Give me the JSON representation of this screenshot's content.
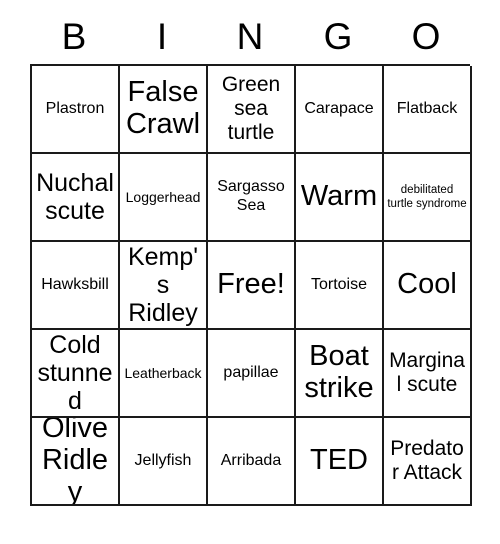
{
  "card": {
    "header": {
      "letters": [
        "B",
        "I",
        "N",
        "G",
        "O"
      ]
    },
    "columns": 5,
    "rows": 5,
    "free_space_label": "Free!",
    "cells": [
      {
        "text": "Plastron",
        "size": "md"
      },
      {
        "text": "False Crawl",
        "size": "xxl"
      },
      {
        "text": "Green sea turtle",
        "size": "lg"
      },
      {
        "text": "Carapace",
        "size": "md"
      },
      {
        "text": "Flatback",
        "size": "md"
      },
      {
        "text": "Nuchal scute",
        "size": "xl"
      },
      {
        "text": "Loggerhead",
        "size": "sm"
      },
      {
        "text": "Sargasso Sea",
        "size": "md"
      },
      {
        "text": "Warm",
        "size": "xxl"
      },
      {
        "text": "debilitated turtle syndrome",
        "size": "xs"
      },
      {
        "text": "Hawksbill",
        "size": "md"
      },
      {
        "text": "Kemp's Ridley",
        "size": "xl"
      },
      {
        "text": "Free!",
        "size": "xxl"
      },
      {
        "text": "Tortoise",
        "size": "md"
      },
      {
        "text": "Cool",
        "size": "xxl"
      },
      {
        "text": "Cold stunned",
        "size": "xl"
      },
      {
        "text": "Leatherback",
        "size": "sm"
      },
      {
        "text": "papillae",
        "size": "md"
      },
      {
        "text": "Boat strike",
        "size": "xxl"
      },
      {
        "text": "Marginal scute",
        "size": "lg"
      },
      {
        "text": "Olive Ridley",
        "size": "xxl"
      },
      {
        "text": "Jellyfish",
        "size": "md"
      },
      {
        "text": "Arribada",
        "size": "md"
      },
      {
        "text": "TED",
        "size": "xxl"
      },
      {
        "text": "Predator Attack",
        "size": "lg"
      }
    ]
  },
  "colors": {
    "background": "#ffffff",
    "border": "#1a1a1a",
    "text": "#000000"
  }
}
